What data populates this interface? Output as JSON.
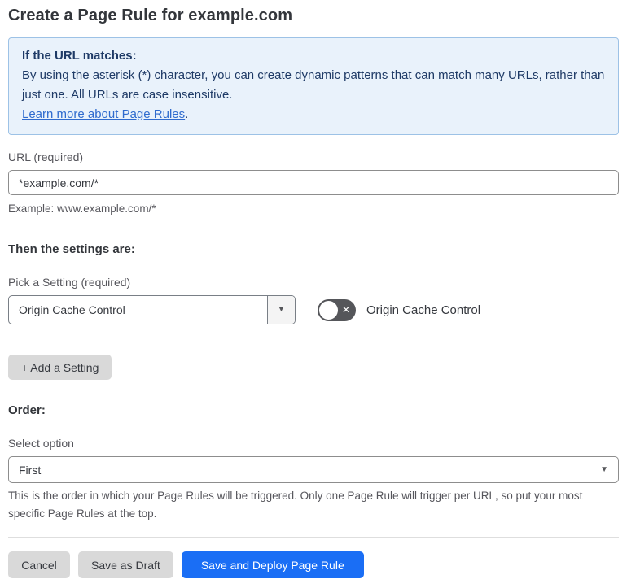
{
  "page": {
    "title": "Create a Page Rule for example.com"
  },
  "info_box": {
    "heading": "If the URL matches:",
    "body": "By using the asterisk (*) character, you can create dynamic patterns that can match many URLs, rather than just one. All URLs are case insensitive.",
    "link_label": "Learn more about Page Rules",
    "link_suffix": "."
  },
  "url_field": {
    "label": "URL (required)",
    "value": "*example.com/*",
    "helper": "Example: www.example.com/*"
  },
  "settings_section": {
    "heading": "Then the settings are:",
    "picker_label": "Pick a Setting (required)",
    "picker_value": "Origin Cache Control",
    "toggle_label": "Origin Cache Control",
    "toggle_state": "off",
    "add_setting_label": "+ Add a Setting"
  },
  "order_section": {
    "heading": "Order:",
    "select_label": "Select option",
    "select_value": "First",
    "helper": "This is the order in which your Page Rules will be triggered. Only one Page Rule will trigger per URL, so put your most specific Page Rules at the top."
  },
  "footer": {
    "cancel_label": "Cancel",
    "save_draft_label": "Save as Draft",
    "save_deploy_label": "Save and Deploy Page Rule"
  },
  "icons": {
    "caret_glyph": "▼",
    "toggle_off_glyph": "✕"
  },
  "colors": {
    "info_bg": "#e9f2fb",
    "info_border": "#9dc2e6",
    "info_text": "#1e3a66",
    "link_blue": "#2f6bce",
    "primary_button_blue": "#1a6ef5",
    "secondary_button_gray": "#d9d9d9",
    "toggle_off_gray": "#55565a"
  }
}
